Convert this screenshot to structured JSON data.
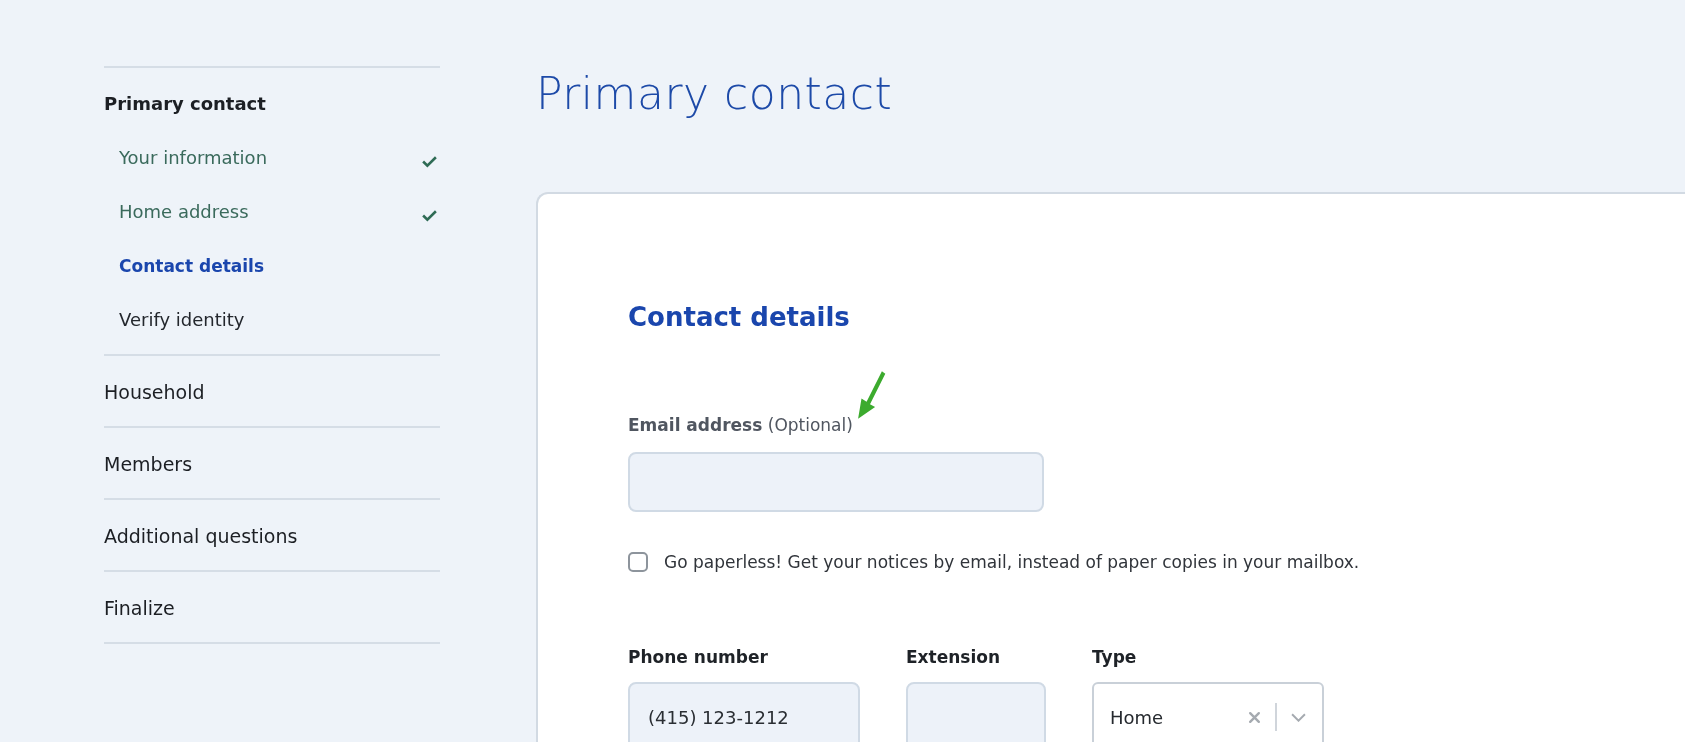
{
  "sidebar": {
    "sections": [
      {
        "label": "Primary contact",
        "selected": true,
        "children": [
          {
            "label": "Your information",
            "completed": true,
            "selected": false
          },
          {
            "label": "Home address",
            "completed": true,
            "selected": false
          },
          {
            "label": "Contact details",
            "completed": false,
            "selected": true
          },
          {
            "label": "Verify identity",
            "completed": false,
            "selected": false
          }
        ]
      },
      {
        "label": "Household",
        "selected": false
      },
      {
        "label": "Members",
        "selected": false
      },
      {
        "label": "Additional questions",
        "selected": false
      },
      {
        "label": "Finalize",
        "selected": false
      }
    ]
  },
  "page_title": "Primary contact",
  "form": {
    "heading": "Contact details",
    "email": {
      "label": "**Email address** (Optional)"
    },
    "paperless": {
      "label": "Go paperless! Get your notices by email, instead of paper copies in your mailbox.",
      "checked": false
    },
    "phone": {
      "label": "Phone number",
      "value": "(415) 123-1212"
    },
    "extension": {
      "label": "Extension"
    },
    "type": {
      "label": "Type",
      "value": "Home"
    }
  }
}
